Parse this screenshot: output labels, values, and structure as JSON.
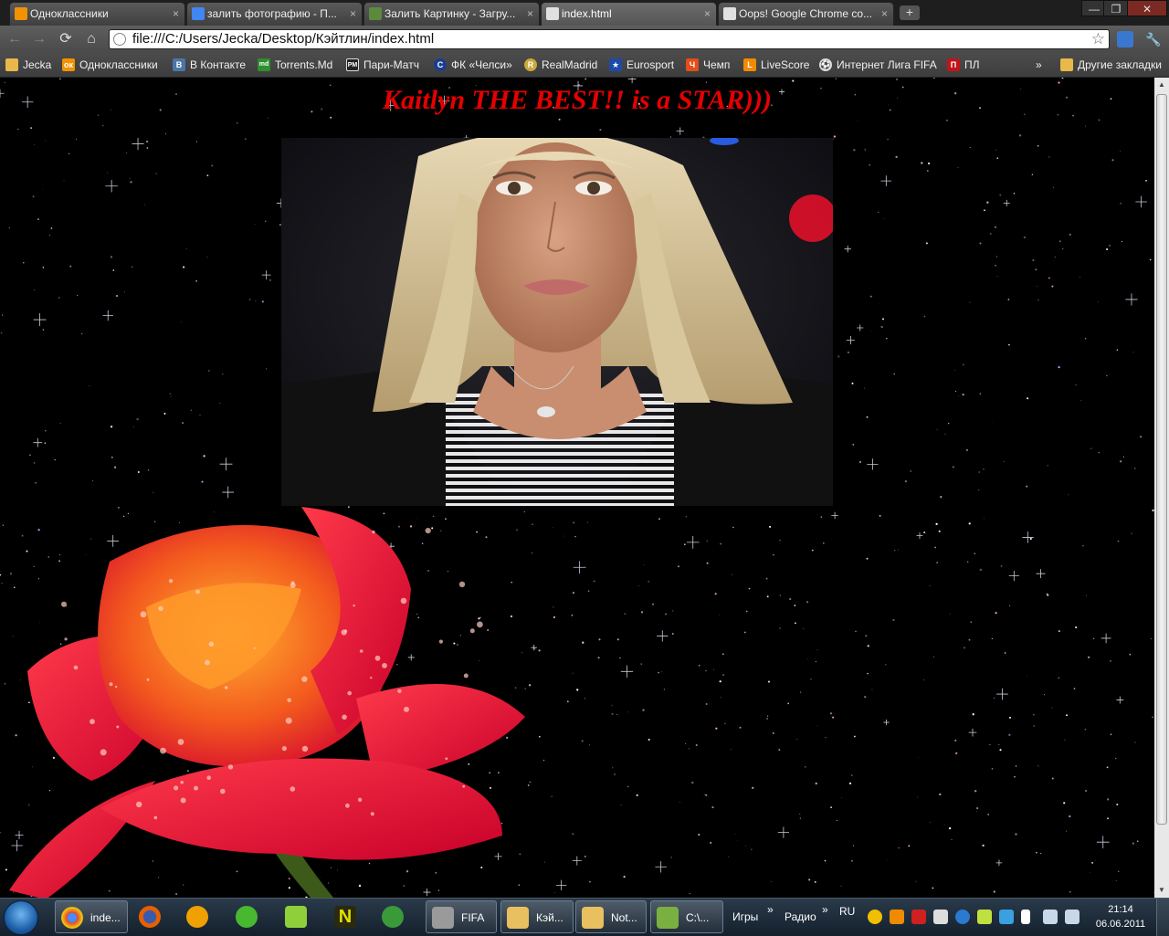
{
  "browser": {
    "tabs": [
      {
        "title": "Одноклассники",
        "color": "#f29200"
      },
      {
        "title": "залить фотографию - П...",
        "color": "#4285f4"
      },
      {
        "title": "Залить Картинку - Загру...",
        "color": "#5b8a3c"
      },
      {
        "title": "index.html",
        "color": "#e0e0e0"
      },
      {
        "title": "Oops! Google Chrome co...",
        "color": "#e0e0e0"
      }
    ],
    "new_tab_label": "+",
    "close_glyph": "×",
    "window_controls": {
      "minimize": "—",
      "maximize": "❐",
      "close": "✕"
    },
    "toolbar": {
      "back": "←",
      "forward": "→",
      "reload": "⟳",
      "home": "⌂",
      "url": "file:///C:/Users/Jecka/Desktop/Кэйтлин/index.html",
      "star": "☆",
      "wrench": "🔧"
    },
    "bookmarks": [
      {
        "label": "Jecka",
        "icon": "folder-icon",
        "color": "#e8b84a",
        "glyph": ""
      },
      {
        "label": "Одноклассники",
        "icon": "odnoklassniki-icon",
        "color": "#f29200",
        "glyph": "ок"
      },
      {
        "label": "В Контакте",
        "icon": "vkontakte-icon",
        "color": "#4a76a8",
        "glyph": "В"
      },
      {
        "label": "Torrents.Md",
        "icon": "torrents-icon",
        "color": "#2f8f2f",
        "glyph": "md"
      },
      {
        "label": "Пари-Матч",
        "icon": "parimatch-icon",
        "color": "#222222",
        "glyph": "PM"
      },
      {
        "label": "ФК «Челси»",
        "icon": "chelsea-icon",
        "color": "#1a3d8f",
        "glyph": "C"
      },
      {
        "label": "RealMadrid",
        "icon": "realmadrid-icon",
        "color": "#c9a93a",
        "glyph": "R"
      },
      {
        "label": "Eurosport",
        "icon": "eurosport-icon",
        "color": "#1d4aa8",
        "glyph": "★"
      },
      {
        "label": "Чемп",
        "icon": "champ-icon",
        "color": "#e54d1a",
        "glyph": "Ч"
      },
      {
        "label": "LiveScore",
        "icon": "livescore-icon",
        "color": "#f28a00",
        "glyph": "L"
      },
      {
        "label": "Интернет Лига FIFA",
        "icon": "fifa-icon",
        "color": "#dddddd",
        "glyph": "⚽"
      },
      {
        "label": "ПЛ",
        "icon": "pl-icon",
        "color": "#c0141a",
        "glyph": "П"
      }
    ],
    "bookmarks_overflow": "»",
    "other_bookmarks": "Другие закладки"
  },
  "page": {
    "heading": "Kaitlyn THE BEST!! is a STAR)))",
    "photo_alt": "Kaitlyn photo",
    "rose_alt": "Red rose",
    "background_color": "#000000",
    "heading_color": "#e60000"
  },
  "taskbar": {
    "buttons": [
      {
        "label": "inde...",
        "icon": "chrome-icon",
        "color": "#e5412f",
        "active": true
      },
      {
        "label": "",
        "icon": "firefox-icon",
        "color": "#e66000",
        "active": false
      },
      {
        "label": "",
        "icon": "aimp-icon",
        "color": "#f0a000",
        "active": false
      },
      {
        "label": "",
        "icon": "icq-icon",
        "color": "#48b830",
        "active": false
      },
      {
        "label": "",
        "icon": "skype-like-icon",
        "color": "#8fcf3a",
        "active": false
      },
      {
        "label": "",
        "icon": "nero-icon",
        "color": "#d0d000",
        "active": false
      },
      {
        "label": "",
        "icon": "utorrent-icon",
        "color": "#3a9a3a",
        "active": false
      },
      {
        "label": "FIFA",
        "icon": "fifa-game-icon",
        "color": "#9a9a9a",
        "active": false
      },
      {
        "label": "Кэй...",
        "icon": "folder-icon",
        "color": "#e8c060",
        "active": false
      },
      {
        "label": "Not...",
        "icon": "notepad-icon",
        "color": "#e8c060",
        "active": false
      },
      {
        "label": "C:\\...",
        "icon": "notepadpp-icon",
        "color": "#7ab040",
        "active": false
      }
    ],
    "toolbars": [
      "Игры",
      "Радио"
    ],
    "toolbar_overflow": "»",
    "language": "RU",
    "clock_time": "21:14",
    "clock_date": "06.06.2011"
  }
}
